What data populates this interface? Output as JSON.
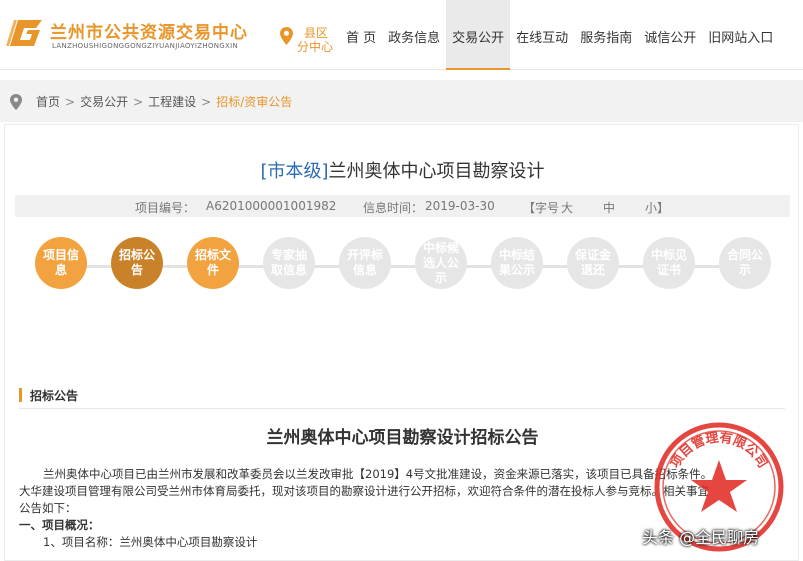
{
  "header": {
    "logo_title": "兰州市公共资源交易中心",
    "logo_subtitle": "LANZHOUSHIGONGGONGZIYUANJIAOYIZHONGXIN",
    "location_line1": "县区",
    "location_line2": "分中心",
    "nav": [
      "首 页",
      "政务信息",
      "交易公开",
      "在线互动",
      "服务指南",
      "诚信公开",
      "旧网站入口"
    ],
    "active_nav": "交易公开",
    "brand_color": "#e8952a"
  },
  "breadcrumb": {
    "items": [
      "首页",
      "交易公开",
      "工程建设"
    ],
    "current": "招标/资审公告",
    "separator": ">"
  },
  "notice": {
    "level": "[市本级]",
    "title": "兰州奥体中心项目勘察设计",
    "project_no_label": "项目编号：",
    "project_no": "A6201000001001982",
    "info_time_label": "信息时间：",
    "info_time": "2019-03-30",
    "font_size_label": "【字号",
    "font_large": "大",
    "font_medium": "中",
    "font_small": "小】"
  },
  "steps": [
    {
      "label": "项目信息",
      "state": "done"
    },
    {
      "label": "招标公告",
      "state": "current"
    },
    {
      "label": "招标文件",
      "state": "done"
    },
    {
      "label": "专家抽取信息",
      "state": "pending"
    },
    {
      "label": "开评标信息",
      "state": "pending"
    },
    {
      "label": "中标候选人公示",
      "state": "pending"
    },
    {
      "label": "中标结果公示",
      "state": "pending"
    },
    {
      "label": "保证金退还",
      "state": "pending"
    },
    {
      "label": "中标见证书",
      "state": "pending"
    },
    {
      "label": "合同公示",
      "state": "pending"
    }
  ],
  "section": {
    "heading": "招标公告",
    "doc_title": "兰州奥体中心项目勘察设计招标公告",
    "para1_line1": "兰州奥体中心项目已由兰州市发展和改革委员会以兰发改审批【2019】4号文批准建设，资金来源已落实，该项目已具备招标条件。",
    "para1_line2": "大华建设项目管理有限公司受兰州市体育局委托，现对该项目的勘察设计进行公开招标，欢迎符合条件的潜在投标人参与竞标。相关事宜",
    "para1_line3": "公告如下：",
    "sub_heading": "一、项目概况：",
    "item1": "1、项目名称：兰州奥体中心项目勘察设计"
  },
  "stamp_text": "项目管理有限公司",
  "watermark": "头条 @全民聊房"
}
